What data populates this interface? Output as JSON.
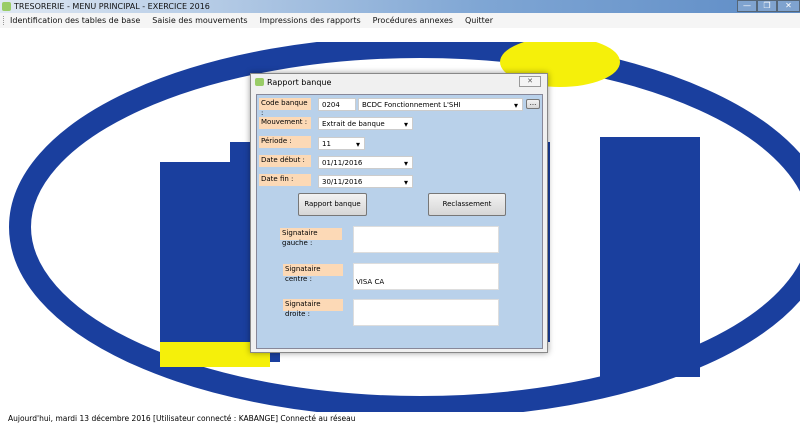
{
  "window": {
    "title": "TRESORERIE - MENU PRINCIPAL - EXERCICE 2016",
    "minimize": "—",
    "restore": "❐",
    "close": "✕"
  },
  "menu": [
    "Identification des tables de base",
    "Saisie des mouvements",
    "Impressions des rapports",
    "Procédures annexes",
    "Quitter"
  ],
  "dialog": {
    "title": "Rapport banque",
    "close": "✕",
    "code_banque_label": "Code banque :",
    "code_banque": "0204",
    "banque_name": "BCDC  Fonctionnement  L'SHI",
    "browse": "...",
    "mouvement_label": "Mouvement :",
    "mouvement": "Extrait de banque",
    "periode_label": "Période :",
    "periode": "11",
    "date_debut_label": "Date début :",
    "date_debut": "01/11/2016",
    "date_fin_label": "Date fin :",
    "date_fin": "30/11/2016",
    "btn_rapport": "Rapport banque",
    "btn_reclassement": "Reclassement",
    "sig_gauche_label": "Signataire gauche :",
    "sig_gauche": "",
    "sig_centre_label": "Signataire centre :",
    "sig_centre": "VISA CA",
    "sig_droite_label": "Signataire droite :",
    "sig_droite": ""
  },
  "status": "Aujourd'hui, mardi 13 décembre 2016  [Utilisateur connecté : KABANGE]  Connecté au réseau",
  "colors": {
    "logo_blue": "#1a3f9e",
    "logo_yellow": "#f5f00a",
    "panel": "#b9d1ea",
    "label_bg": "#fcd9b6"
  }
}
